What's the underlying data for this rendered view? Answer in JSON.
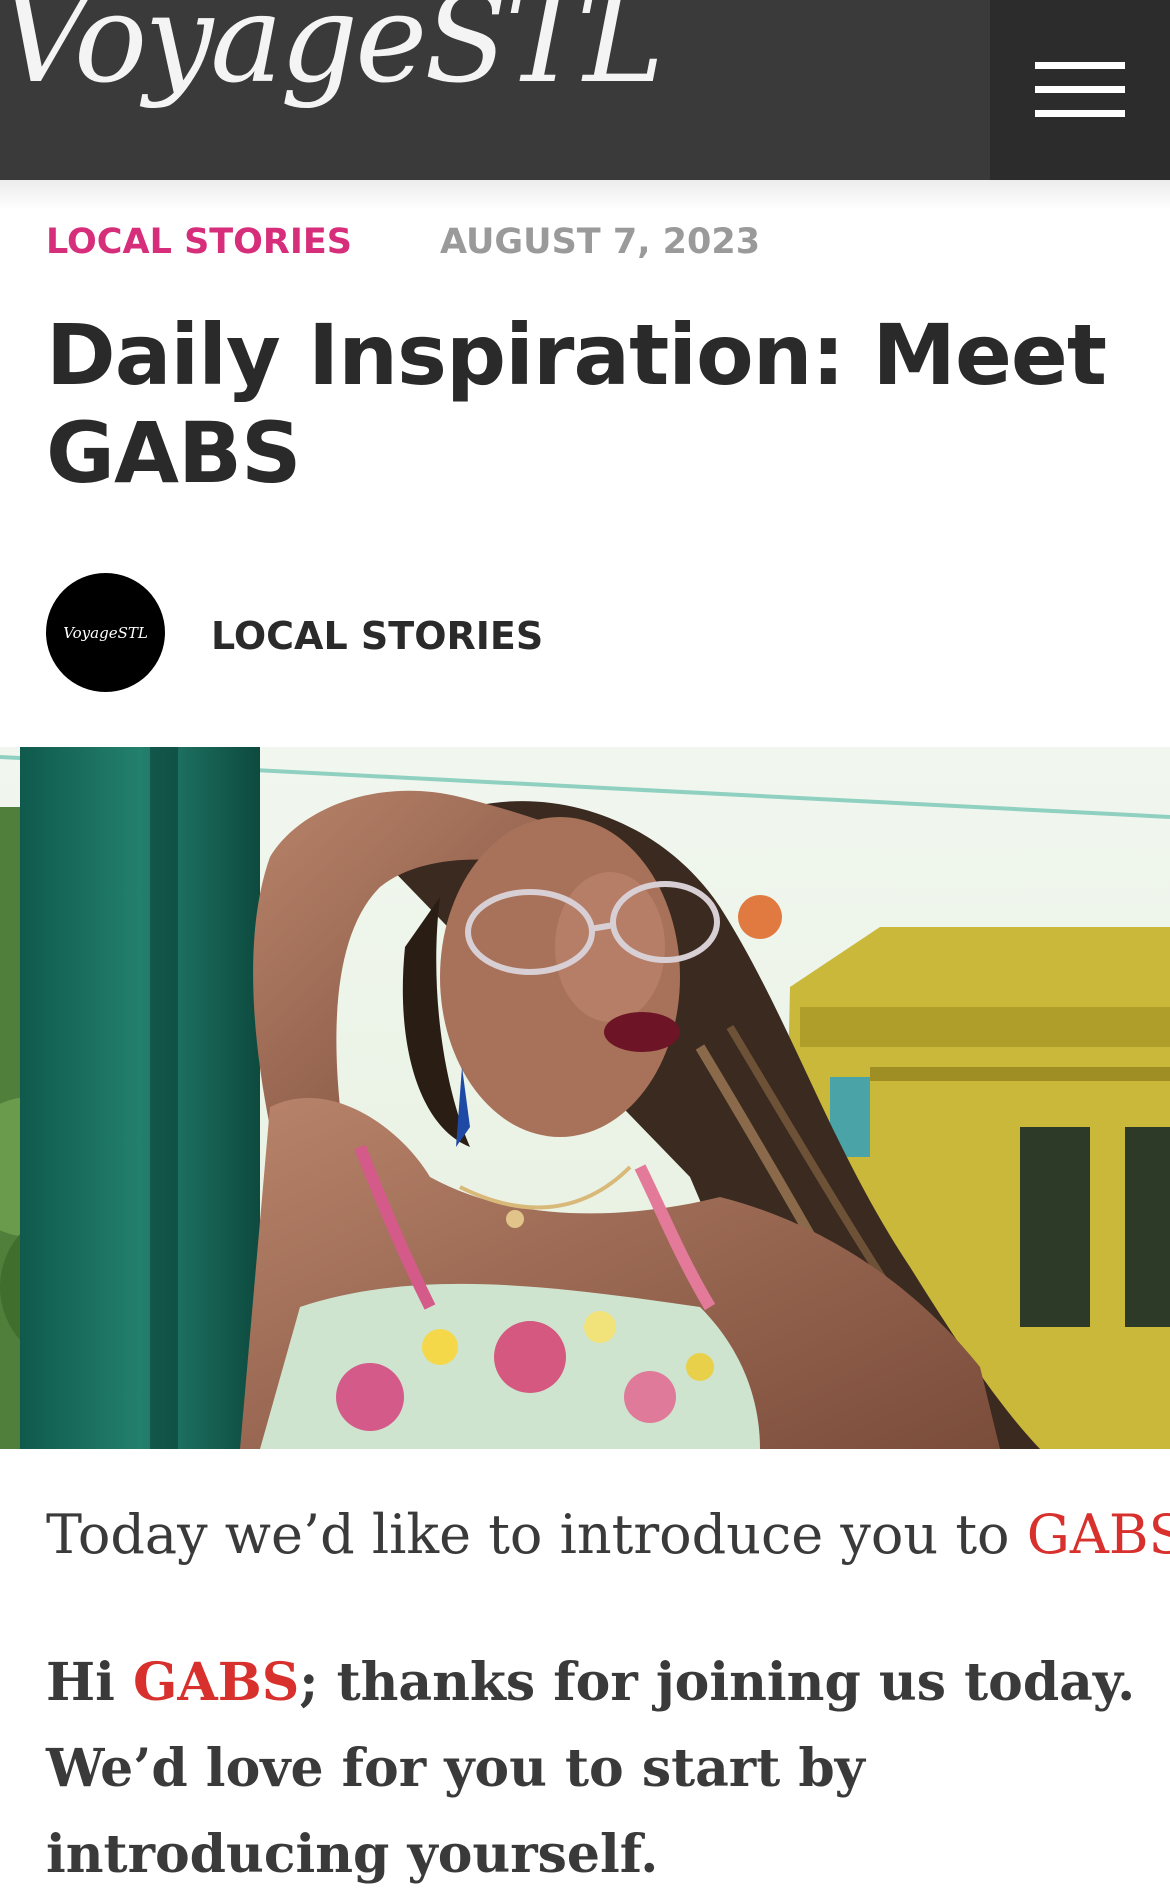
{
  "header": {
    "logo_text": "VoyageSTL",
    "menu_icon": "hamburger-menu-icon",
    "background_color": "#3a3a3a"
  },
  "article": {
    "category": "LOCAL STORIES",
    "date": "AUGUST 7, 2023",
    "title": "Daily Inspiration: Meet GABS",
    "author": {
      "avatar_text": "VoyageSTL",
      "name": "LOCAL STORIES"
    },
    "intro": {
      "prefix": "Today we’d like to introduce you to ",
      "link": "GABS",
      "suffix": "."
    },
    "question": {
      "prefix": "Hi ",
      "link": "GABS",
      "suffix": "; thanks for joining us today. We’d love for you to start by introducing yourself."
    }
  },
  "colors": {
    "category_accent": "#d72e7b",
    "link_accent": "#d8302c",
    "date_gray": "#9a9a9a",
    "text_dark": "#2a2a2a"
  }
}
